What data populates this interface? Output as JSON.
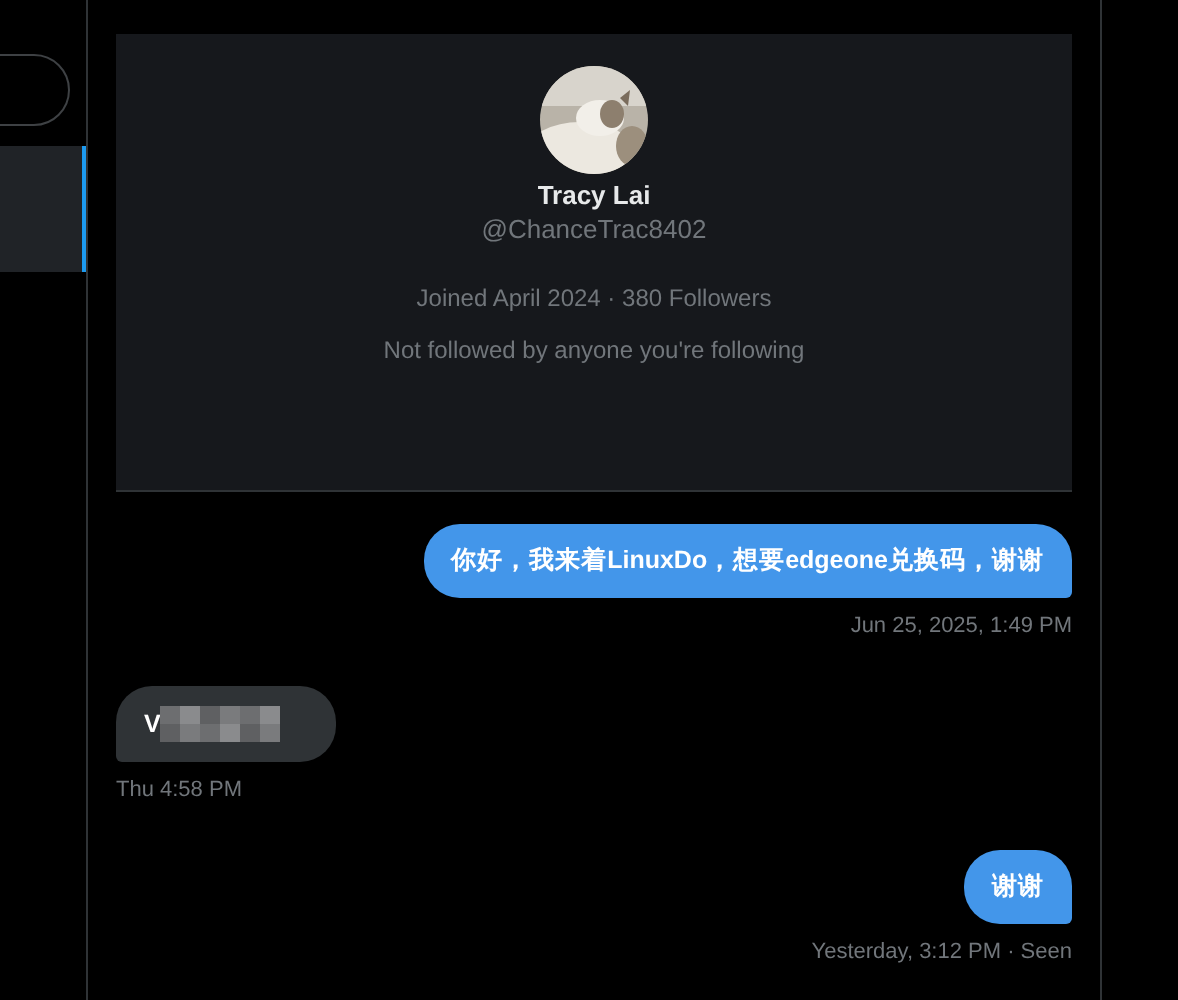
{
  "sidebar": {
    "conversations": [
      {
        "selected": true
      }
    ]
  },
  "profile": {
    "name": "Tracy Lai",
    "handle": "@ChanceTrac8402",
    "stats": "Joined April 2024 · 380 Followers",
    "mutuals": "Not followed by anyone you're following"
  },
  "messages": [
    {
      "kind": "sent",
      "text": "你好，我来着LinuxDo，想要edgeone兑换码，谢谢",
      "redacted": false,
      "meta": "Jun 25, 2025, 1:49 PM"
    },
    {
      "kind": "received",
      "text": "V",
      "redacted": true,
      "meta": "Thu 4:58 PM"
    },
    {
      "kind": "sent",
      "text": "谢谢",
      "redacted": false,
      "meta": "Yesterday, 3:12 PM · Seen"
    }
  ]
}
